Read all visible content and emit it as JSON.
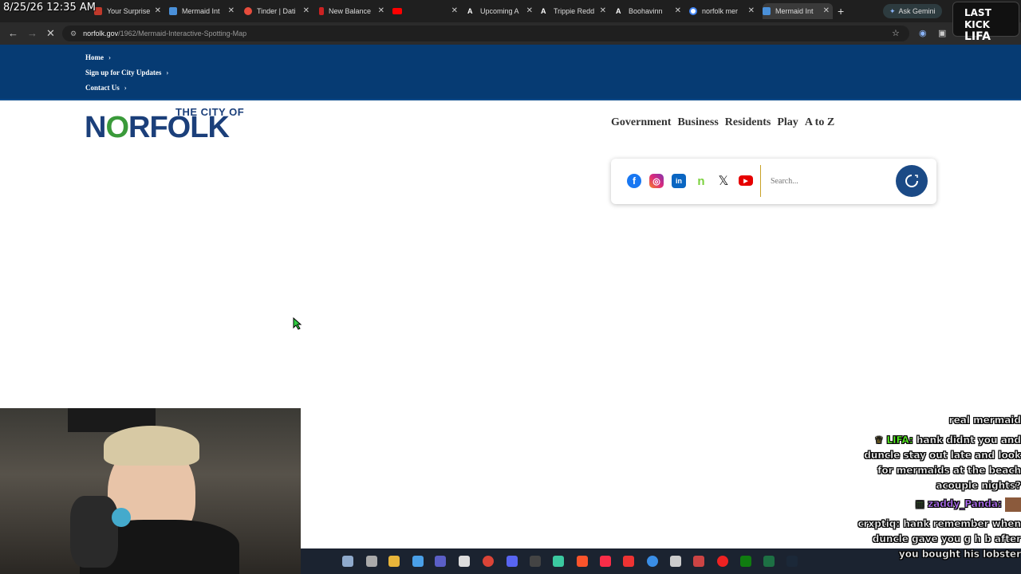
{
  "overlay": {
    "datetime": "8/25/26 12:35 AM",
    "last_kick": "LAST KICK",
    "last_kick_name": "LIFA"
  },
  "browser": {
    "tabs": [
      {
        "label": "Your Surprise",
        "favicon_color": "#c0392b"
      },
      {
        "label": "Mermaid Int",
        "favicon_color": "#4a90d9"
      },
      {
        "label": "Tinder | Dati",
        "favicon_color": "#e74c3c"
      },
      {
        "label": "New Balance",
        "favicon_color": "#cc2222"
      },
      {
        "label": "",
        "favicon_color": "#ff0000"
      },
      {
        "label": "Upcoming A",
        "favicon_color": "#ffffff"
      },
      {
        "label": "Trippie Redd",
        "favicon_color": "#ffffff"
      },
      {
        "label": "Boohavinn",
        "favicon_color": "#ffffff"
      },
      {
        "label": "norfolk mer",
        "favicon_color": "#4285f4"
      },
      {
        "label": "Mermaid Int",
        "favicon_color": "#4a90d9"
      }
    ],
    "ask_gemini": "Ask Gemini",
    "url_host": "norfolk.gov",
    "url_path": "/1962/Mermaid-Interactive-Spotting-Map"
  },
  "site": {
    "utility_links": [
      "Home",
      "Sign up for City Updates",
      "Contact Us"
    ],
    "logo_small": "THE CITY OF",
    "logo_big_pre": "N",
    "logo_big_o": "O",
    "logo_big_post": "RFOLK",
    "primary_nav": [
      "Government",
      "Business",
      "Residents",
      "Play",
      "A to Z"
    ],
    "social": [
      "facebook",
      "instagram",
      "linkedin",
      "nextdoor",
      "x",
      "youtube"
    ],
    "search_placeholder": "Search..."
  },
  "chat": [
    {
      "user": "",
      "text": "real mermaid"
    },
    {
      "user": "LIFA",
      "text": "hank didnt you and duncle stay out late and look for mermaids at the beach acouple nights?"
    },
    {
      "user": "zaddy_Panda",
      "text": ""
    },
    {
      "user": "crxptiq",
      "text": "hank remember when duncle gave you g h b after you bought his lobster"
    }
  ]
}
